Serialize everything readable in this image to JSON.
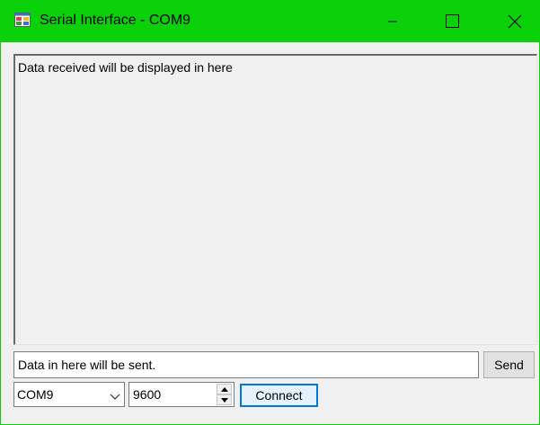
{
  "window": {
    "title": "Serial Interface - COM9",
    "accent_color": "#0ad10a"
  },
  "received": {
    "text": "Data received will be displayed in here"
  },
  "send": {
    "input_value": "Data in here will be sent.",
    "button_label": "Send"
  },
  "connection": {
    "port": "COM9",
    "baud": "9600",
    "connect_label": "Connect"
  },
  "icons": {
    "app": "app-window-icon",
    "minimize": "minimize-icon",
    "maximize": "maximize-icon",
    "close": "close-icon",
    "dropdown": "chevron-down-icon",
    "spin_up": "arrow-up-icon",
    "spin_down": "arrow-down-icon"
  }
}
